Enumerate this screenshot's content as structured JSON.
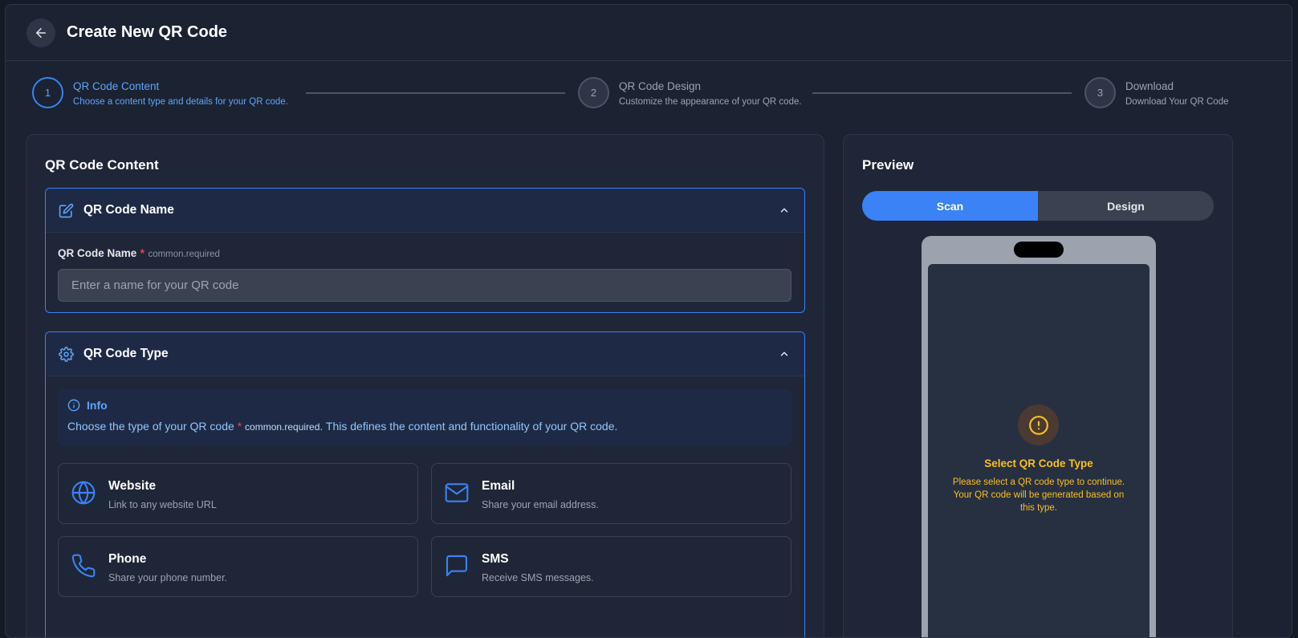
{
  "header": {
    "title": "Create New QR Code"
  },
  "stepper": {
    "steps": [
      {
        "number": "1",
        "title": "QR Code Content",
        "desc": "Choose a content type and details for your QR code."
      },
      {
        "number": "2",
        "title": "QR Code Design",
        "desc": "Customize the appearance of your QR code."
      },
      {
        "number": "3",
        "title": "Download",
        "desc": "Download Your QR Code"
      }
    ]
  },
  "content": {
    "title": "QR Code Content",
    "name_section": {
      "title": "QR Code Name",
      "label": "QR Code Name",
      "required_star": "*",
      "required_note": "common.required",
      "input_value": "",
      "input_placeholder": "Enter a name for your QR code"
    },
    "type_section": {
      "title": "QR Code Type",
      "info_title": "Info",
      "info_text_before": "Choose the type of your QR code ",
      "info_star": "*",
      "info_required_note": "common.required",
      "info_text_after": ". This defines the content and functionality of your QR code.",
      "types": [
        {
          "title": "Website",
          "desc": "Link to any website URL",
          "icon": "globe-icon"
        },
        {
          "title": "Email",
          "desc": "Share your email address.",
          "icon": "mail-icon"
        },
        {
          "title": "Phone",
          "desc": "Share your phone number.",
          "icon": "phone-icon"
        },
        {
          "title": "SMS",
          "desc": "Receive SMS messages.",
          "icon": "message-icon"
        }
      ]
    }
  },
  "preview": {
    "title": "Preview",
    "tabs": [
      "Scan",
      "Design"
    ],
    "active_tab": "Scan",
    "warning_title": "Select QR Code Type",
    "warning_text": "Please select a QR code type to continue. Your QR code will be generated based on this type."
  },
  "colors": {
    "accent": "#3b82f6",
    "accent_light": "#60a5fa",
    "warning": "#fbbf24",
    "background": "#1b2232"
  }
}
